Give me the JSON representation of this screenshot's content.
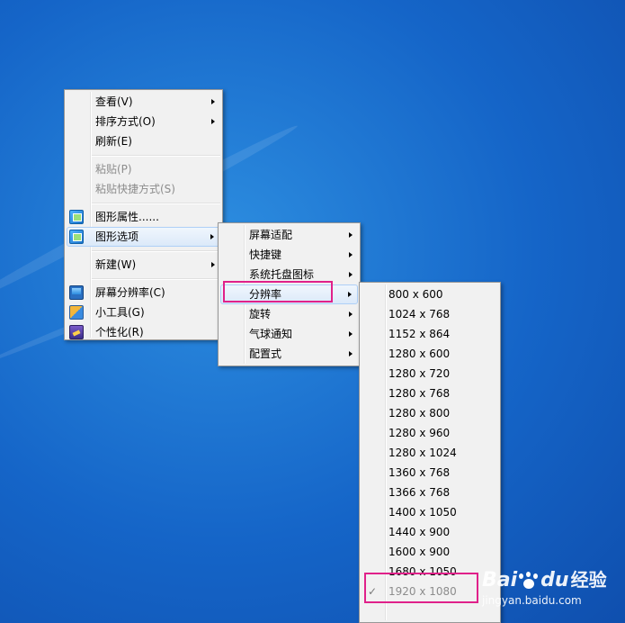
{
  "context_menu": {
    "items": [
      {
        "label": "查看(V)",
        "arrow": true
      },
      {
        "label": "排序方式(O)",
        "arrow": true
      },
      {
        "label": "刷新(E)"
      },
      {
        "label": "粘贴(P)",
        "disabled": true
      },
      {
        "label": "粘贴快捷方式(S)",
        "disabled": true
      },
      {
        "label": "图形属性......",
        "icon": "graphics-icon"
      },
      {
        "label": "图形选项",
        "icon": "graphics-icon",
        "arrow": true,
        "highlighted": true
      },
      {
        "label": "新建(W)",
        "arrow": true
      },
      {
        "label": "屏幕分辨率(C)",
        "icon": "screen-icon"
      },
      {
        "label": "小工具(G)",
        "icon": "gadget-icon"
      },
      {
        "label": "个性化(R)",
        "icon": "personalize-icon"
      }
    ]
  },
  "graphics_submenu": {
    "items": [
      {
        "label": "屏幕适配"
      },
      {
        "label": "快捷键"
      },
      {
        "label": "系统托盘图标"
      },
      {
        "label": "分辨率",
        "highlighted": true
      },
      {
        "label": "旋转"
      },
      {
        "label": "气球通知"
      },
      {
        "label": "配置式"
      }
    ]
  },
  "resolution_submenu": {
    "items": [
      "800 x 600",
      "1024 x 768",
      "1152 x 864",
      "1280 x 600",
      "1280 x 720",
      "1280 x 768",
      "1280 x 800",
      "1280 x 960",
      "1280 x 1024",
      "1360 x 768",
      "1366 x 768",
      "1400 x 1050",
      "1440 x 900",
      "1600 x 900",
      "1680 x 1050",
      "1920 x 1080"
    ],
    "selected": "1920 x 1080",
    "check_mark": "✓"
  },
  "watermark": {
    "brand": "Bai",
    "brand2": "du",
    "suffix": "经验",
    "url": "jingyan.baidu.com"
  },
  "colors": {
    "callout": "#e0218a",
    "desktop": "#1565c8"
  }
}
